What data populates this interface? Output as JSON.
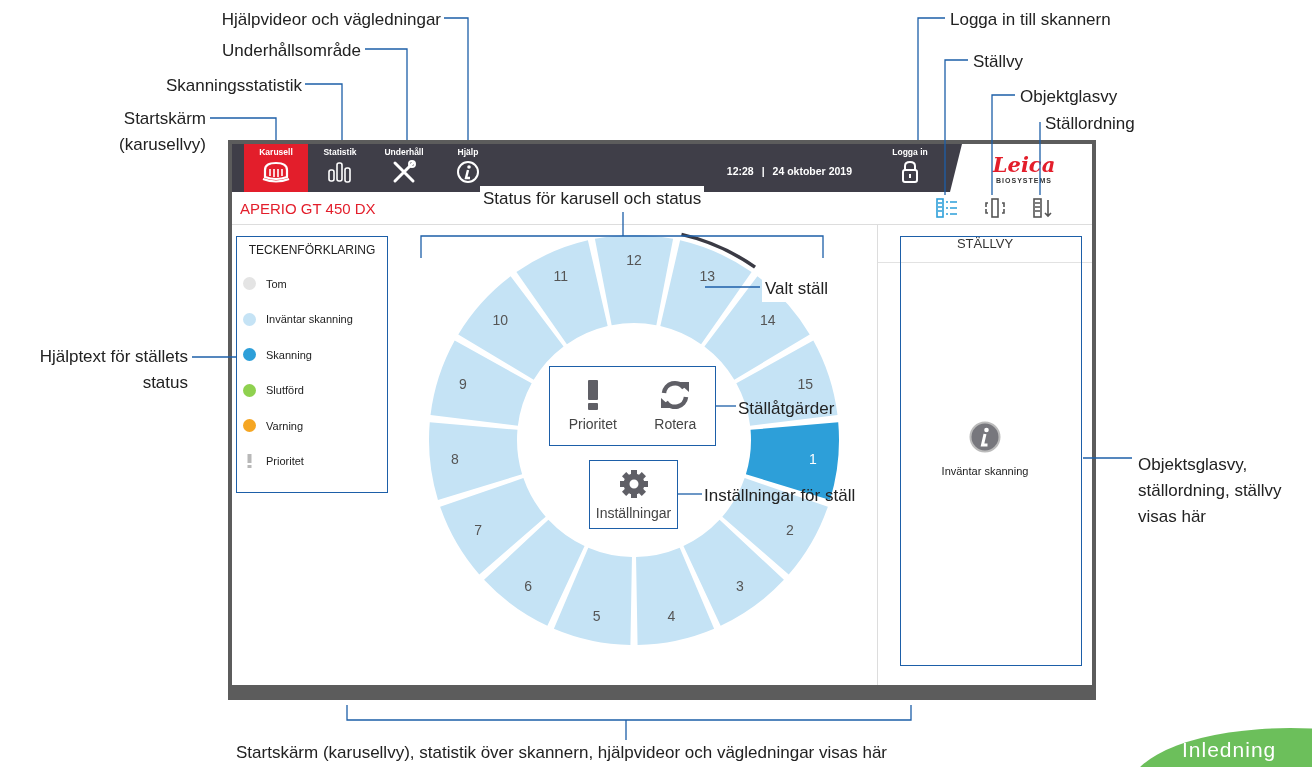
{
  "callouts": [
    {
      "text": "Hjälpvideor och vägledningar"
    },
    {
      "text": "Logga in till skannern"
    },
    {
      "text": "Underhållsområde"
    },
    {
      "text": "Ställvy"
    },
    {
      "text": "Skanningsstatistik"
    },
    {
      "text": "Objektglasvy"
    },
    {
      "text": "Startskärm (karusellvy)"
    },
    {
      "text": "Ställordning"
    },
    {
      "text": "Status för karusell och status"
    },
    {
      "text": "Valt ställ"
    },
    {
      "text": "Hjälptext för ställets status"
    },
    {
      "text": "Ställåtgärder"
    },
    {
      "text": "Inställningar för ställ"
    },
    {
      "text": "Objektsglasvy, ställordning, ställvy visas här"
    },
    {
      "text": "Startskärm (karusellvy), statistik över skannern, hjälpvideor och vägledningar visas här"
    }
  ],
  "screen": {
    "tabs": [
      {
        "label": "Karusell",
        "kind": "carousel",
        "selected": true
      },
      {
        "label": "Statistik",
        "kind": "stats",
        "selected": false
      },
      {
        "label": "Underhåll",
        "kind": "tools",
        "selected": false
      },
      {
        "label": "Hjälp",
        "kind": "info",
        "selected": false
      }
    ],
    "time": "12:28",
    "separator": "|",
    "date": "24 oktober 2019",
    "login": "Logga in",
    "logo": {
      "name": "Leica",
      "sub": "BIOSYSTEMS"
    },
    "product": "APERIO GT 450 DX",
    "views": [
      {
        "kind": "rack",
        "selected": true
      },
      {
        "kind": "slide",
        "selected": false
      },
      {
        "kind": "order",
        "selected": false
      }
    ],
    "legend": {
      "title": "TECKENFÖRKLARING",
      "items": [
        {
          "label": "Tom",
          "kind": "dot",
          "color": "#e4e4e4"
        },
        {
          "label": "Inväntar skanning",
          "kind": "dot",
          "color": "#c5e3f5"
        },
        {
          "label": "Skanning",
          "kind": "dot",
          "color": "#2d9fd9"
        },
        {
          "label": "Slutförd",
          "kind": "dot",
          "color": "#8fd14f"
        },
        {
          "label": "Varning",
          "kind": "dot",
          "color": "#f5a623"
        },
        {
          "label": "Prioritet",
          "kind": "priority"
        }
      ]
    },
    "carousel": {
      "slots": [
        {
          "number": "1",
          "color": "#2d9fd9",
          "selected": false
        },
        {
          "number": "2",
          "color": "#c5e3f5",
          "selected": false
        },
        {
          "number": "3",
          "color": "#c5e3f5",
          "selected": false
        },
        {
          "number": "4",
          "color": "#c5e3f5",
          "selected": false
        },
        {
          "number": "5",
          "color": "#c5e3f5",
          "selected": false
        },
        {
          "number": "6",
          "color": "#c5e3f5",
          "selected": false
        },
        {
          "number": "7",
          "color": "#c5e3f5",
          "selected": false
        },
        {
          "number": "8",
          "color": "#c5e3f5",
          "selected": false
        },
        {
          "number": "9",
          "color": "#c5e3f5",
          "selected": false
        },
        {
          "number": "10",
          "color": "#c5e3f5",
          "selected": false
        },
        {
          "number": "11",
          "color": "#c5e3f5",
          "selected": false
        },
        {
          "number": "12",
          "color": "#c5e3f5",
          "selected": false
        },
        {
          "number": "13",
          "color": "#c5e3f5",
          "selected": true
        },
        {
          "number": "14",
          "color": "#c5e3f5",
          "selected": false
        },
        {
          "number": "15",
          "color": "#c5e3f5",
          "selected": false
        }
      ]
    },
    "actions": [
      {
        "label": "Prioritet",
        "kind": "priority"
      },
      {
        "label": "Rotera",
        "kind": "rotate"
      }
    ],
    "settings": {
      "label": "Inställningar"
    },
    "panel": {
      "title": "STÄLLVY",
      "message": "Inväntar skanning"
    }
  },
  "page_tab": "Inledning"
}
